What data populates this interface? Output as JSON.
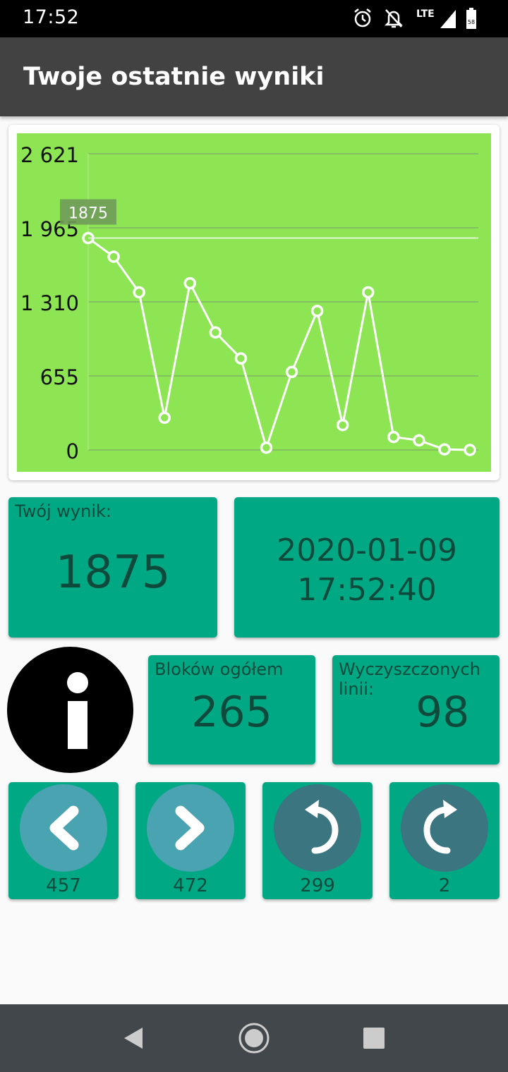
{
  "status_bar": {
    "time": "17:52",
    "network": "LTE",
    "battery": "58",
    "icons": [
      "alarm-icon",
      "notifications-off-icon",
      "signal-icon",
      "battery-icon"
    ]
  },
  "app_bar": {
    "title": "Twoje ostatnie wyniki"
  },
  "chart_data": {
    "type": "line",
    "y_ticks": [
      "2 621",
      "1 965",
      "1 310",
      "655",
      "0"
    ],
    "ylim": [
      0,
      2621
    ],
    "x": [
      1,
      2,
      3,
      4,
      5,
      6,
      7,
      8,
      9,
      10,
      11,
      12,
      13,
      14,
      15,
      16
    ],
    "series": [
      {
        "values": [
          1875,
          1710,
          1395,
          285,
          1475,
          1040,
          810,
          20,
          690,
          1230,
          220,
          1395,
          115,
          85,
          5,
          0
        ]
      }
    ],
    "highlight": {
      "index": 0,
      "label": "1875"
    },
    "grid": true,
    "colors": {
      "background": "#8ee554",
      "line": "#ffffff",
      "grid": "#7a9a6a"
    }
  },
  "score": {
    "caption": "Twój wynik:",
    "value": "1875"
  },
  "datetime": {
    "date": "2020-01-09",
    "time": "17:52:40"
  },
  "blocks": {
    "caption": "Bloków ogółem",
    "value": "265"
  },
  "lines_cleared": {
    "caption": "Wyczyszczonych linii:",
    "value": "98"
  },
  "navigation": [
    {
      "name": "previous",
      "icon": "chevron-left-icon",
      "count": "457",
      "color": "#4aa3b0"
    },
    {
      "name": "next",
      "icon": "chevron-right-icon",
      "count": "472",
      "color": "#4aa3b0"
    },
    {
      "name": "undo",
      "icon": "undo-icon",
      "count": "299",
      "color": "#3a7580"
    },
    {
      "name": "redo",
      "icon": "redo-icon",
      "count": "2",
      "color": "#3a7580"
    }
  ],
  "colors": {
    "tile": "#00a884",
    "tile_text": "#0d4a3c",
    "app_bar": "#424242"
  }
}
